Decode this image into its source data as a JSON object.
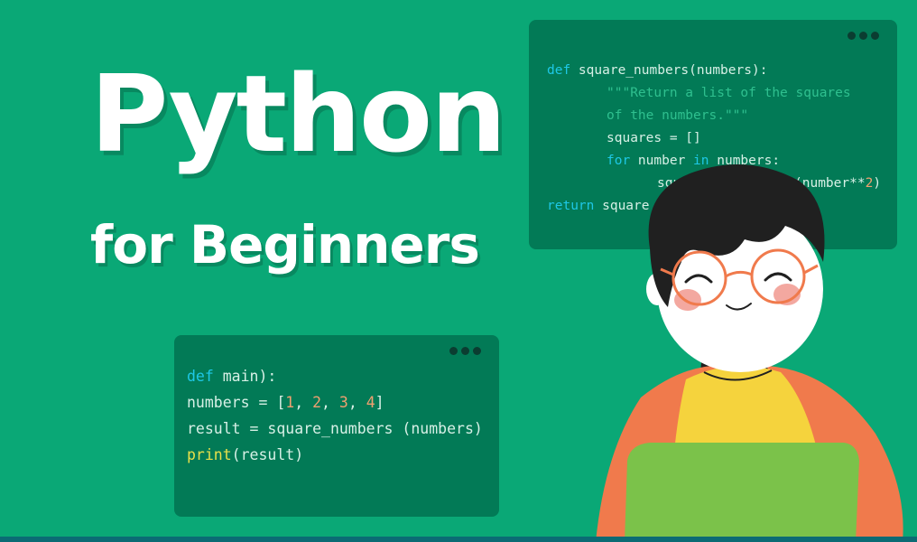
{
  "title": "Python",
  "subtitle": "for Beginners",
  "code_top": {
    "lines": [
      {
        "kw": "def ",
        "text": "square_numbers(numbers):"
      },
      {
        "str": "\"\"\"Return a list of the squares"
      },
      {
        "str": "of the numbers.\"\"\""
      },
      {
        "text": "squares = []"
      },
      {
        "kw": "for ",
        "text": "number ",
        "kw2": "in ",
        "text2": "numbers:"
      },
      {
        "text": "squ",
        "text2": "(number**",
        "num": "2",
        "text3": ")"
      },
      {
        "kw": "return ",
        "text": "square"
      }
    ]
  },
  "code_bottom": {
    "line1_kw": "def ",
    "line1_fn": "main):",
    "line2_a": "numbers = [",
    "n1": "1",
    "c1": ", ",
    "n2": "2",
    "c2": ", ",
    "n3": "3",
    "c3": ", ",
    "n4": "4",
    "line2_end": "]",
    "line3": "result = square_numbers (numbers)",
    "line4_fn": "print",
    "line4_rest": "(result)"
  },
  "colors": {
    "background": "#0aa876",
    "code_window": "#027a56",
    "keyword": "#1ec8e6",
    "string": "#2fc08f",
    "number": "#f0a070",
    "print": "#e8e04a",
    "shirt_yellow": "#f5d33d",
    "jacket_orange": "#f07a4c",
    "laptop_green": "#7bc24a"
  }
}
